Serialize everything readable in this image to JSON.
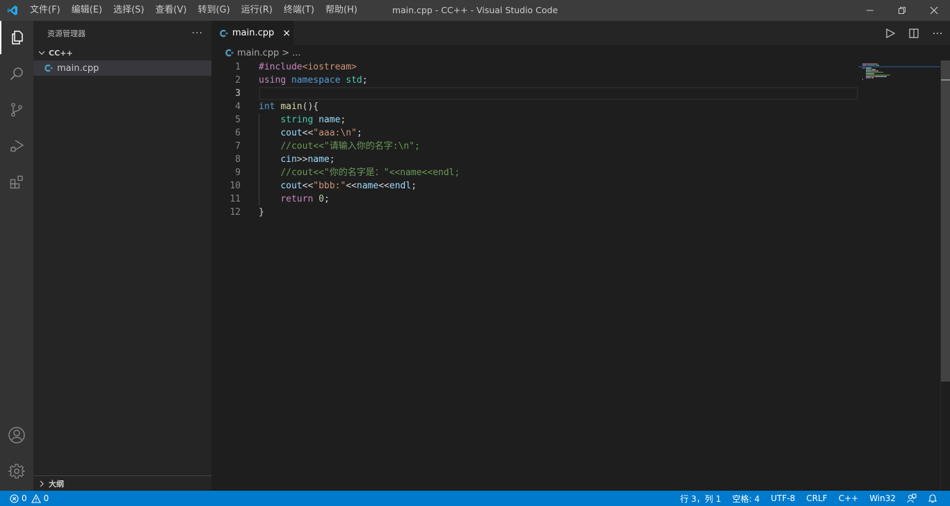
{
  "titlebar": {
    "menu": [
      {
        "label": "文件(F)"
      },
      {
        "label": "编辑(E)"
      },
      {
        "label": "选择(S)"
      },
      {
        "label": "查看(V)"
      },
      {
        "label": "转到(G)"
      },
      {
        "label": "运行(R)"
      },
      {
        "label": "终端(T)"
      },
      {
        "label": "帮助(H)"
      }
    ],
    "window_title": "main.cpp - CC++ - Visual Studio Code",
    "brand_color": "#23a9f2"
  },
  "activitybar": {
    "items": [
      {
        "name": "explorer",
        "icon": "files-icon",
        "active": true
      },
      {
        "name": "search",
        "icon": "search-icon"
      },
      {
        "name": "source-control",
        "icon": "source-control-icon"
      },
      {
        "name": "run-debug",
        "icon": "run-debug-icon"
      },
      {
        "name": "extensions",
        "icon": "extensions-icon"
      }
    ],
    "bottom": [
      {
        "name": "accounts",
        "icon": "account-icon"
      },
      {
        "name": "manage",
        "icon": "gear-icon"
      }
    ]
  },
  "sidebar": {
    "title": "资源管理器",
    "more": "···",
    "folder": "CC++",
    "files": [
      {
        "name": "main.cpp",
        "icon": "cpp-file-icon",
        "selected": true
      }
    ],
    "outline_label": "大纲"
  },
  "editor": {
    "tab": {
      "label": "main.cpp",
      "close": "×"
    },
    "breadcrumb": {
      "file": "main.cpp",
      "sep": ">",
      "rest": "..."
    },
    "current_line": 3,
    "lines": [
      {
        "n": "1",
        "tokens": [
          {
            "t": "#include",
            "c": "k-pre"
          },
          {
            "t": "<iostream>",
            "c": "k-inc"
          }
        ]
      },
      {
        "n": "2",
        "tokens": [
          {
            "t": "using",
            "c": "k-ctl"
          },
          {
            "t": " ",
            "c": "k-pl"
          },
          {
            "t": "namespace",
            "c": "k-kw"
          },
          {
            "t": " ",
            "c": "k-pl"
          },
          {
            "t": "std",
            "c": "k-type"
          },
          {
            "t": ";",
            "c": "k-pl"
          }
        ]
      },
      {
        "n": "3",
        "tokens": []
      },
      {
        "n": "4",
        "tokens": [
          {
            "t": "int",
            "c": "k-kw"
          },
          {
            "t": " ",
            "c": "k-pl"
          },
          {
            "t": "main",
            "c": "k-fn"
          },
          {
            "t": "(){",
            "c": "k-pl"
          }
        ]
      },
      {
        "n": "5",
        "tokens": [
          {
            "t": "    ",
            "c": "k-pl"
          },
          {
            "t": "string",
            "c": "k-type"
          },
          {
            "t": " ",
            "c": "k-pl"
          },
          {
            "t": "name",
            "c": "k-var"
          },
          {
            "t": ";",
            "c": "k-pl"
          }
        ]
      },
      {
        "n": "6",
        "tokens": [
          {
            "t": "    ",
            "c": "k-pl"
          },
          {
            "t": "cout",
            "c": "k-var"
          },
          {
            "t": "<<",
            "c": "k-pl"
          },
          {
            "t": "\"aaa:\\n\"",
            "c": "k-str"
          },
          {
            "t": ";",
            "c": "k-pl"
          }
        ]
      },
      {
        "n": "7",
        "tokens": [
          {
            "t": "    ",
            "c": "k-pl"
          },
          {
            "t": "//cout<<\"请输入你的名字:\\n\";",
            "c": "k-com"
          }
        ]
      },
      {
        "n": "8",
        "tokens": [
          {
            "t": "    ",
            "c": "k-pl"
          },
          {
            "t": "cin",
            "c": "k-var"
          },
          {
            "t": ">>",
            "c": "k-pl"
          },
          {
            "t": "name",
            "c": "k-var"
          },
          {
            "t": ";",
            "c": "k-pl"
          }
        ]
      },
      {
        "n": "9",
        "tokens": [
          {
            "t": "    ",
            "c": "k-pl"
          },
          {
            "t": "//cout<<\"你的名字是：\"<<name<<endl;",
            "c": "k-com"
          }
        ]
      },
      {
        "n": "10",
        "tokens": [
          {
            "t": "    ",
            "c": "k-pl"
          },
          {
            "t": "cout",
            "c": "k-var"
          },
          {
            "t": "<<",
            "c": "k-pl"
          },
          {
            "t": "\"bbb:\"",
            "c": "k-str"
          },
          {
            "t": "<<",
            "c": "k-pl"
          },
          {
            "t": "name",
            "c": "k-var"
          },
          {
            "t": "<<",
            "c": "k-pl"
          },
          {
            "t": "endl",
            "c": "k-var"
          },
          {
            "t": ";",
            "c": "k-pl"
          }
        ]
      },
      {
        "n": "11",
        "tokens": [
          {
            "t": "    ",
            "c": "k-pl"
          },
          {
            "t": "return",
            "c": "k-ctl"
          },
          {
            "t": " ",
            "c": "k-pl"
          },
          {
            "t": "0",
            "c": "k-num"
          },
          {
            "t": ";",
            "c": "k-pl"
          }
        ]
      },
      {
        "n": "12",
        "tokens": [
          {
            "t": "}",
            "c": "k-pl"
          }
        ]
      }
    ]
  },
  "statusbar": {
    "errors": "0",
    "warnings": "0",
    "position": "行 3，列 1",
    "indent": "空格: 4",
    "encoding": "UTF-8",
    "eol": "CRLF",
    "language": "C++",
    "platform": "Win32",
    "color": "#007acc"
  }
}
